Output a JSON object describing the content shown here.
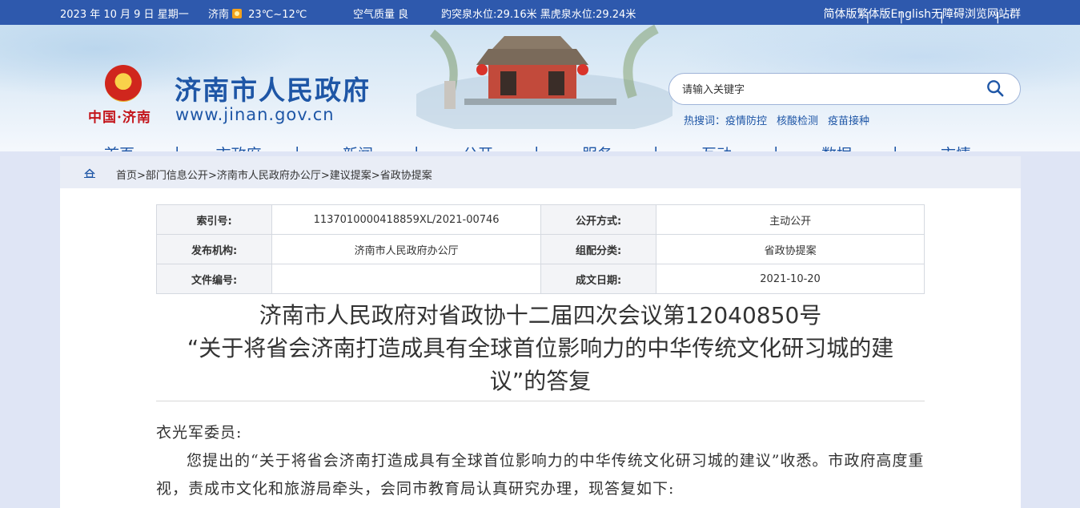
{
  "topbar": {
    "date": "2023 年 10 月 9 日 星期一",
    "city": "济南",
    "temperature": "23℃~12℃",
    "air_quality": "空气质量 良",
    "water_levels": "趵突泉水位:29.16米 黑虎泉水位:29.24米",
    "links": [
      "简体版",
      "繁体版",
      "English",
      "无障碍浏览",
      "网站群"
    ]
  },
  "header": {
    "logo_text": "中国·济南",
    "site_title": "济南市人民政府",
    "site_url": "www.jinan.gov.cn"
  },
  "search": {
    "placeholder": "请输入关键字",
    "hot_label": "热搜词：",
    "hot_words": [
      "疫情防控",
      "核酸检测",
      "疫苗接种"
    ]
  },
  "nav": [
    "首页",
    "市政府",
    "新闻",
    "公开",
    "服务",
    "互动",
    "数据",
    "市情"
  ],
  "breadcrumb": [
    "首页",
    "部门信息公开",
    "济南市人民政府办公厅",
    "建议提案",
    "省政协提案"
  ],
  "meta": {
    "index_label": "索引号:",
    "index_value": "1137010000418859XL/2021-00746",
    "open_label": "公开方式:",
    "open_value": "主动公开",
    "org_label": "发布机构:",
    "org_value": "济南市人民政府办公厅",
    "category_label": "组配分类:",
    "category_value": "省政协提案",
    "docno_label": "文件编号:",
    "docno_value": "",
    "date_label": "成文日期:",
    "date_value": "2021-10-20"
  },
  "document": {
    "title_line1": "济南市人民政府对省政协十二届四次会议第12040850号",
    "title_line2": "“关于将省会济南打造成具有全球首位影响力的中华传统文化研习城的建",
    "title_line3": "议”的答复",
    "salutation": "衣光军委员:",
    "para1": "您提出的“关于将省会济南打造成具有全球首位影响力的中华传统文化研习城的建议”收悉。市政府高度重视，责成市文化和旅游局牵头，会同市教育局认真研究办理，现答复如下:"
  }
}
